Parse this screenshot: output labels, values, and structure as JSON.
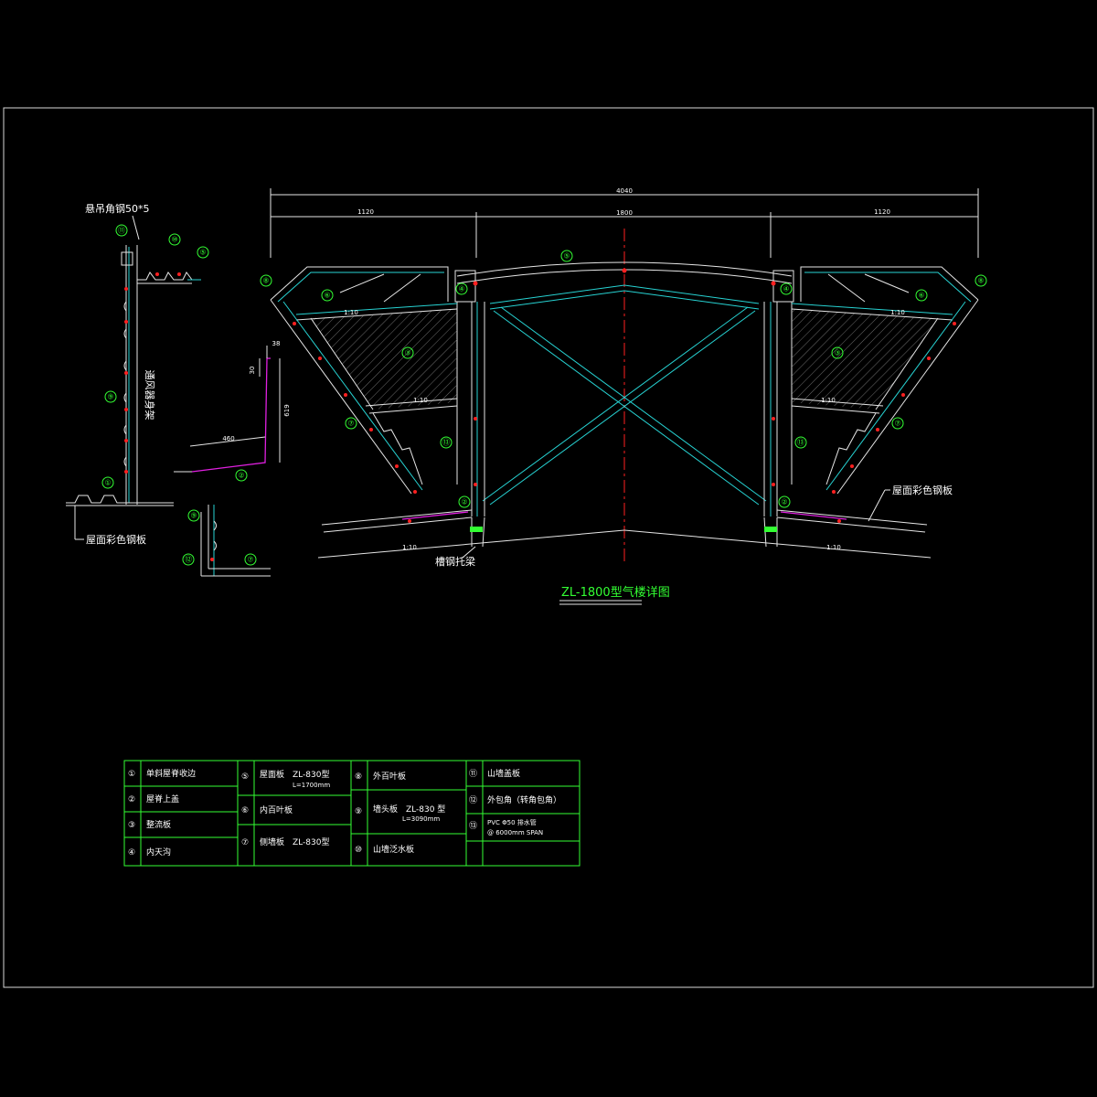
{
  "drawing": {
    "title": "ZL-1800型气楼详图",
    "overall_dim": "4040",
    "dim_left": "1120",
    "dim_center": "1800",
    "dim_right": "1120",
    "slope": "1:10",
    "roof_panel_label": "屋面彩色钢板",
    "purlin_label": "槽钢托梁"
  },
  "left_detail": {
    "angle_label": "悬吊角钢50*5",
    "vertical_label": "通风器身架",
    "roof_label": "屋面彩色钢板"
  },
  "small_detail": {
    "dim_38": "38",
    "dim_30": "30",
    "dim_619": "619",
    "dim_460": "460"
  },
  "callouts": [
    "①",
    "②",
    "③",
    "④",
    "⑤",
    "⑥",
    "⑦",
    "⑧",
    "⑨",
    "⑩",
    "⑪",
    "⑫",
    "⑬"
  ],
  "legend": {
    "col1": [
      {
        "num": "①",
        "text": "单斜屋脊收边"
      },
      {
        "num": "②",
        "text": "屋脊上盖"
      },
      {
        "num": "③",
        "text": "整流板"
      },
      {
        "num": "④",
        "text": "内天沟"
      }
    ],
    "col2": [
      {
        "num": "⑤",
        "text": "屋面板　ZL-830型",
        "sub": "L=1700mm"
      },
      {
        "num": "⑥",
        "text": "内百叶板",
        "sub": ""
      },
      {
        "num": "⑦",
        "text": "侧墙板　ZL-830型",
        "sub": ""
      }
    ],
    "col3": [
      {
        "num": "⑧",
        "text": "外百叶板",
        "sub": ""
      },
      {
        "num": "⑨",
        "text": "墙头板　ZL-830 型",
        "sub": "L=3090mm"
      },
      {
        "num": "⑩",
        "text": "山墙泛水板",
        "sub": ""
      }
    ],
    "col4": [
      {
        "num": "⑪",
        "text": "山墙盖板",
        "sub": ""
      },
      {
        "num": "⑫",
        "text": "外包角（转角包角）",
        "sub": ""
      },
      {
        "num": "⑬",
        "text": "PVC Φ50 排水管",
        "sub": "@ 6000mm  SPAN"
      }
    ]
  }
}
